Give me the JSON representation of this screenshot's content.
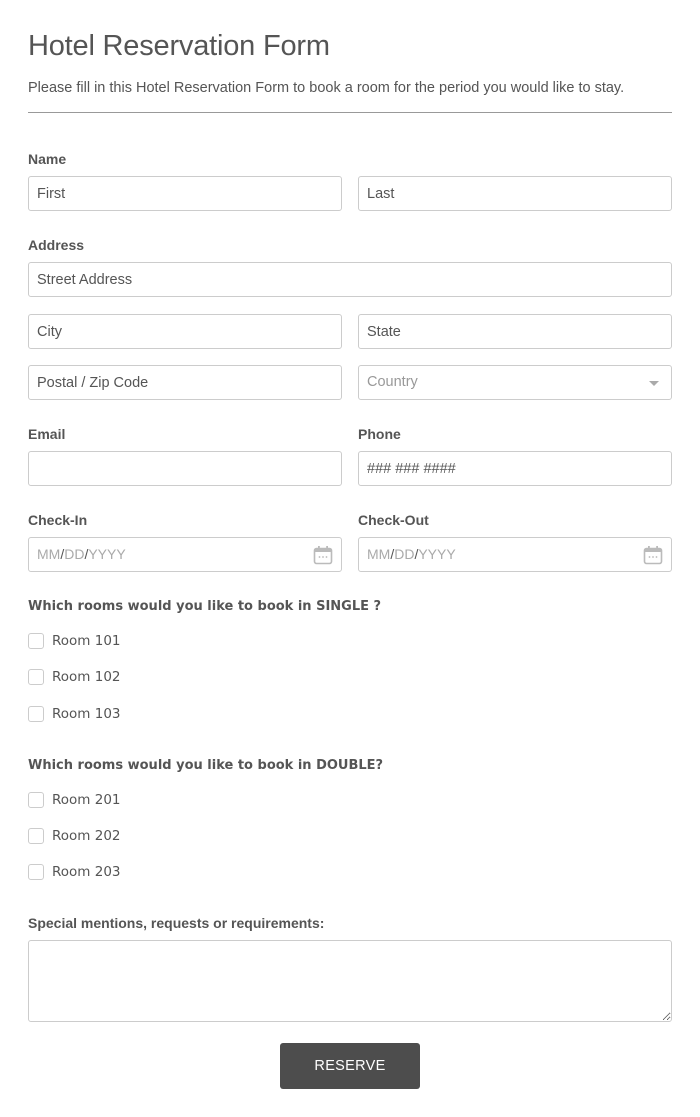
{
  "header": {
    "title": "Hotel Reservation Form",
    "subtitle": "Please fill in this Hotel Reservation Form to book a room for the period you would like to stay."
  },
  "name": {
    "label": "Name",
    "first_placeholder": "First",
    "last_placeholder": "Last"
  },
  "address": {
    "label": "Address",
    "street_placeholder": "Street Address",
    "city_placeholder": "City",
    "state_placeholder": "State",
    "postal_placeholder": "Postal / Zip Code",
    "country_selected": "Country"
  },
  "email": {
    "label": "Email",
    "value": ""
  },
  "phone": {
    "label": "Phone",
    "placeholder": "### ### ####"
  },
  "checkin": {
    "label": "Check-In",
    "mm": "MM",
    "dd": "DD",
    "yyyy": "YYYY",
    "sep": "/"
  },
  "checkout": {
    "label": "Check-Out",
    "mm": "MM",
    "dd": "DD",
    "yyyy": "YYYY",
    "sep": "/"
  },
  "single": {
    "question": "Which rooms would you like to book in SINGLE ?",
    "options": [
      {
        "label": "Room 101",
        "checked": false
      },
      {
        "label": "Room 102",
        "checked": false
      },
      {
        "label": "Room 103",
        "checked": false
      }
    ]
  },
  "double": {
    "question": "Which rooms would you like to book in DOUBLE?",
    "options": [
      {
        "label": "Room 201",
        "checked": false
      },
      {
        "label": "Room 202",
        "checked": false
      },
      {
        "label": "Room 203",
        "checked": false
      }
    ]
  },
  "special": {
    "label": "Special mentions, requests or requirements:",
    "value": ""
  },
  "submit": {
    "label": "RESERVE"
  },
  "colors": {
    "button_bg": "#4d4d4d",
    "text": "#555555",
    "border": "#cccccc"
  }
}
